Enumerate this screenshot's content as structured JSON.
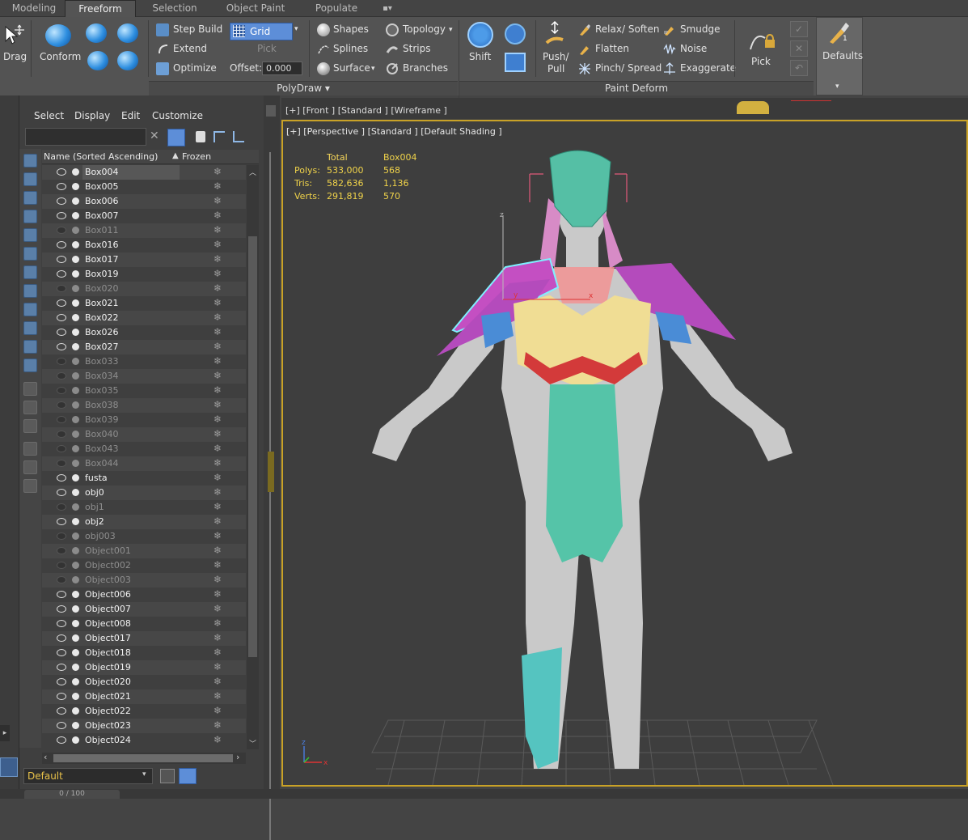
{
  "tabs": [
    "Modeling",
    "Freeform",
    "Selection",
    "Object Paint",
    "Populate",
    "▪▾"
  ],
  "ribbon": {
    "drag": "Drag",
    "conform": "Conform",
    "step_build": "Step Build",
    "extend": "Extend",
    "optimize": "Optimize",
    "grid": "Grid",
    "pick_dim": "Pick",
    "offset_label": "Offset:",
    "offset_value": "0.000",
    "shapes": "Shapes",
    "splines": "Splines",
    "surface": "Surface",
    "topology": "Topology",
    "strips": "Strips",
    "branches": "Branches",
    "polydraw": "PolyDraw",
    "shift": "Shift",
    "push_pull_1": "Push/",
    "push_pull_2": "Pull",
    "relax": "Relax/ Soften",
    "flatten": "Flatten",
    "pinch": "Pinch/ Spread",
    "smudge": "Smudge",
    "noise": "Noise",
    "exaggerate": "Exaggerate",
    "pick": "Pick",
    "paint_deform": "Paint Deform",
    "defaults": "Defaults"
  },
  "explorer": {
    "menu": [
      "Select",
      "Display",
      "Edit",
      "Customize"
    ],
    "col_name": "Name (Sorted Ascending)",
    "col_frozen": "Frozen",
    "layer": "Default",
    "rows": [
      {
        "name": "Box004",
        "visible": true
      },
      {
        "name": "Box005",
        "visible": true
      },
      {
        "name": "Box006",
        "visible": true
      },
      {
        "name": "Box007",
        "visible": true
      },
      {
        "name": "Box011",
        "visible": false
      },
      {
        "name": "Box016",
        "visible": true
      },
      {
        "name": "Box017",
        "visible": true
      },
      {
        "name": "Box019",
        "visible": true
      },
      {
        "name": "Box020",
        "visible": false
      },
      {
        "name": "Box021",
        "visible": true
      },
      {
        "name": "Box022",
        "visible": true
      },
      {
        "name": "Box026",
        "visible": true
      },
      {
        "name": "Box027",
        "visible": true
      },
      {
        "name": "Box033",
        "visible": false
      },
      {
        "name": "Box034",
        "visible": false
      },
      {
        "name": "Box035",
        "visible": false
      },
      {
        "name": "Box038",
        "visible": false
      },
      {
        "name": "Box039",
        "visible": false
      },
      {
        "name": "Box040",
        "visible": false
      },
      {
        "name": "Box043",
        "visible": false
      },
      {
        "name": "Box044",
        "visible": false
      },
      {
        "name": "fusta",
        "visible": true
      },
      {
        "name": "obj0",
        "visible": true
      },
      {
        "name": "obj1",
        "visible": false
      },
      {
        "name": "obj2",
        "visible": true
      },
      {
        "name": "obj003",
        "visible": false
      },
      {
        "name": "Object001",
        "visible": false
      },
      {
        "name": "Object002",
        "visible": false
      },
      {
        "name": "Object003",
        "visible": false
      },
      {
        "name": "Object006",
        "visible": true
      },
      {
        "name": "Object007",
        "visible": true
      },
      {
        "name": "Object008",
        "visible": true
      },
      {
        "name": "Object017",
        "visible": true
      },
      {
        "name": "Object018",
        "visible": true
      },
      {
        "name": "Object019",
        "visible": true
      },
      {
        "name": "Object020",
        "visible": true
      },
      {
        "name": "Object021",
        "visible": true
      },
      {
        "name": "Object022",
        "visible": true
      },
      {
        "name": "Object023",
        "visible": true
      },
      {
        "name": "Object024",
        "visible": true
      }
    ]
  },
  "viewport": {
    "front_label": "[+] [Front ] [Standard ] [Wireframe ]",
    "label": "[+] [Perspective ] [Standard ] [Default Shading ]",
    "stats": {
      "h_total": "Total",
      "h_obj": "Box004",
      "polys_label": "Polys:",
      "polys_total": "533,000",
      "polys_obj": "568",
      "tris_label": "Tris:",
      "tris_total": "582,636",
      "tris_obj": "1,136",
      "verts_label": "Verts:",
      "verts_total": "291,819",
      "verts_obj": "570"
    },
    "axis_z": "z",
    "axis_x": "x",
    "axis_y": "y"
  },
  "status": {
    "frame": "0 / 100"
  }
}
